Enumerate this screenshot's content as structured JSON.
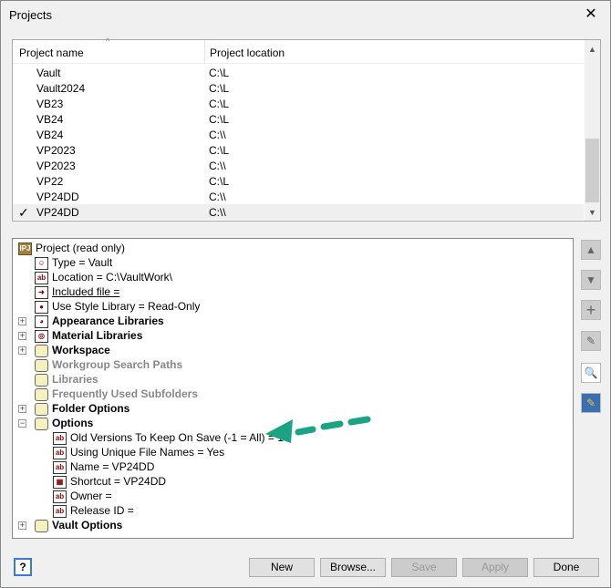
{
  "window": {
    "title": "Projects",
    "close": "✕"
  },
  "list": {
    "columns": [
      "Project name",
      "Project location"
    ],
    "rows": [
      {
        "name": "Vault",
        "location": "C:\\L"
      },
      {
        "name": "Vault2024",
        "location": "C:\\L"
      },
      {
        "name": "VB23",
        "location": "C:\\L"
      },
      {
        "name": "VB24",
        "location": "C:\\L"
      },
      {
        "name": "VB24",
        "location": "C:\\\\"
      },
      {
        "name": "VP2023",
        "location": "C:\\L"
      },
      {
        "name": "VP2023",
        "location": "C:\\\\"
      },
      {
        "name": "VP22",
        "location": "C:\\L"
      },
      {
        "name": "VP24DD",
        "location": "C:\\\\"
      },
      {
        "name": "VP24DD",
        "location": "C:\\\\",
        "active": "✓"
      }
    ]
  },
  "tree": {
    "items": [
      {
        "text": "Project (read only)",
        "icon": "IPJ"
      },
      {
        "text": "Type = Vault",
        "icon": "☺"
      },
      {
        "text": "Location = C:\\VaultWork\\",
        "icon": "ab"
      },
      {
        "text": "Included file =",
        "icon": "➜"
      },
      {
        "text": "Use Style Library = Read-Only",
        "icon": "●"
      },
      {
        "text": "Appearance Libraries",
        "icon": "◕"
      },
      {
        "text": "Material Libraries",
        "icon": "◎"
      },
      {
        "text": "Workspace",
        "icon": ""
      },
      {
        "text": "Workgroup Search Paths",
        "icon": ""
      },
      {
        "text": "Libraries",
        "icon": ""
      },
      {
        "text": "Frequently Used Subfolders",
        "icon": ""
      },
      {
        "text": "Folder Options",
        "icon": ""
      },
      {
        "text": "Options",
        "icon": ""
      },
      {
        "text": "Old Versions To Keep On Save (-1 = All) = 1",
        "icon": "ab"
      },
      {
        "text": "Using Unique File Names = Yes",
        "icon": "ab"
      },
      {
        "text": "Name = VP24DD",
        "icon": "ab"
      },
      {
        "text": "Shortcut = VP24DD",
        "icon": "▦"
      },
      {
        "text": "Owner =",
        "icon": "ab"
      },
      {
        "text": "Release ID =",
        "icon": "ab"
      },
      {
        "text": "Vault Options",
        "icon": ""
      }
    ],
    "expand": "+",
    "collapse": "−"
  },
  "buttons": {
    "new": "New",
    "browse": "Browse...",
    "save": "Save",
    "apply": "Apply",
    "done": "Done",
    "help": "?"
  },
  "colors": {
    "arrow": "#1aa384"
  }
}
